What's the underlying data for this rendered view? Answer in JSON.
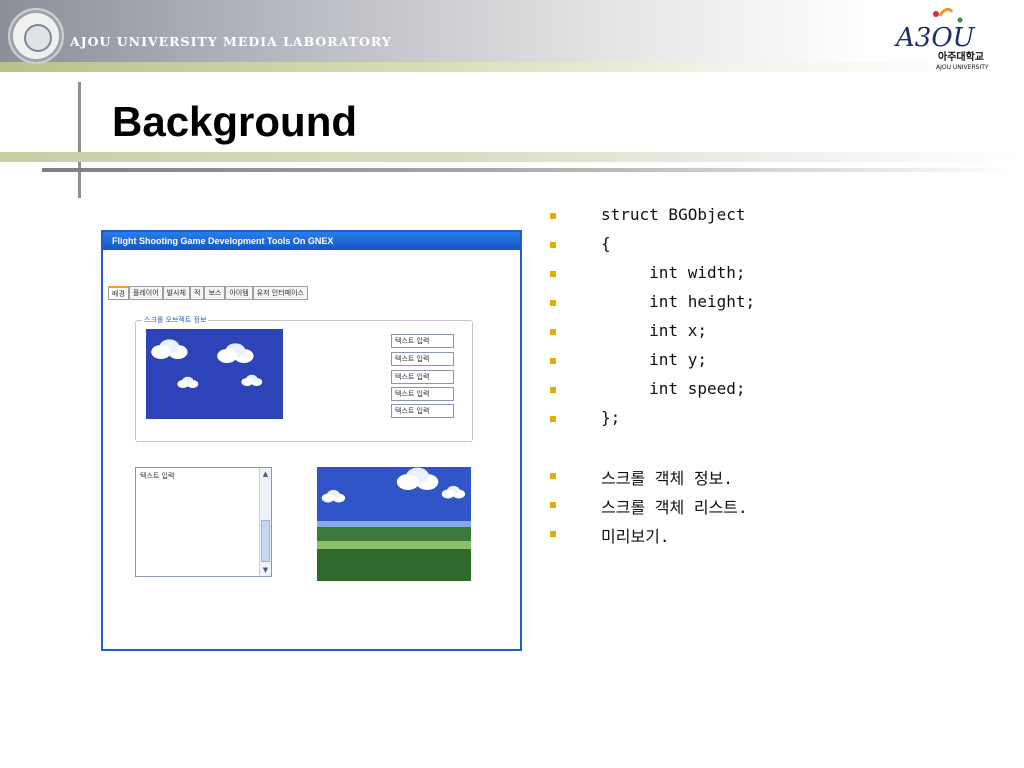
{
  "header": {
    "institution": "AJOU UNIVERSITY MEDIA LABORATORY",
    "logo_text": "A3OU",
    "logo_korean": "아주대학교",
    "logo_english": "AJOU UNIVERSITY"
  },
  "slide": {
    "title": "Background"
  },
  "app_window": {
    "title": "Flight Shooting Game Development Tools On GNEX",
    "tabs": [
      "배경",
      "플레이어",
      "발사체",
      "적",
      "보스",
      "아이템",
      "유저 인터페이스"
    ],
    "active_tab": "배경",
    "group_label": "스크롤 오브젝트 정보",
    "fields": [
      "텍스트 입력",
      "텍스트 입력",
      "텍스트 입력",
      "텍스트 입력",
      "텍스트 입력"
    ],
    "listbox_text": "텍스트 입력",
    "scroll_up": "▲",
    "scroll_down": "▼"
  },
  "bullets": {
    "code": [
      "struct BGObject",
      "{",
      "     int width;",
      "     int height;",
      "     int x;",
      "     int y;",
      "     int speed;",
      "};"
    ],
    "notes": [
      "스크롤 객체 정보.",
      "스크롤 객체 리스트.",
      "미리보기."
    ]
  },
  "colors": {
    "bullet": "#e0b000",
    "window_border": "#1f5bd1"
  }
}
